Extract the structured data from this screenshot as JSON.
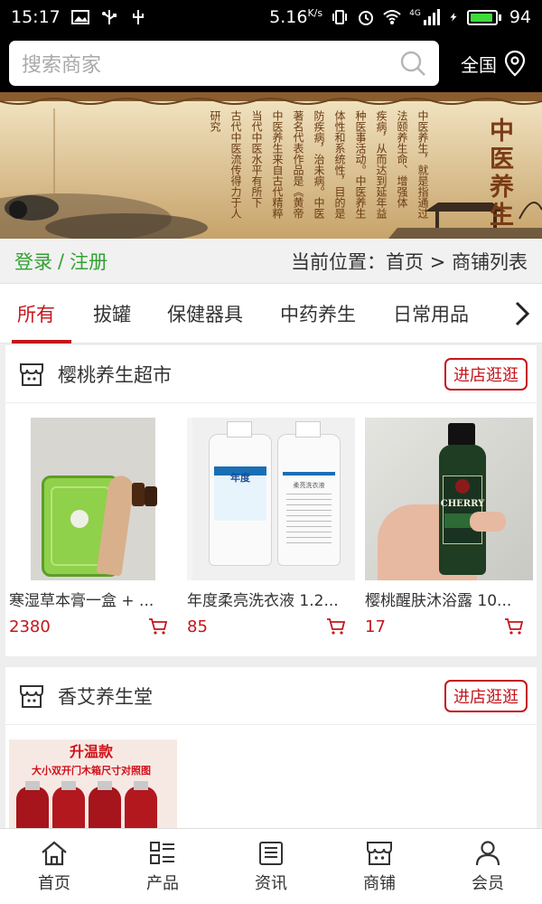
{
  "status_bar": {
    "time": "15:17",
    "speed": "5.16",
    "speed_unit": "K/s",
    "network": "4G",
    "battery": "94",
    "battery_level": 0.94,
    "icons": [
      "image-icon",
      "usb-icon",
      "vibrate-icon",
      "alarm-icon",
      "wifi-icon",
      "signal-icon",
      "charging-icon",
      "battery-icon"
    ]
  },
  "header": {
    "search_placeholder": "搜索商家",
    "region_label": "全国"
  },
  "banner": {
    "title": "中医养生",
    "columns": [
      "中医养生，就是指通过各种方",
      "法颐养生命、增强体质、预防",
      "疾病，从而达到延年益寿的一",
      "种医事活动。中医养生重在整",
      "体性和系统性，目的是提前预",
      "防疾病，治未病。中医理论的",
      "著名代表作品是《黄帝内经》",
      "中医养生来自古代精粹医学",
      "当代中医水平有所下降，而",
      "古代中医流传得力于人进步",
      "研究"
    ]
  },
  "breadcrumb": {
    "login": "登录",
    "separator": "/",
    "register": "注册",
    "position": "当前位置：首页 > 商铺列表"
  },
  "tabs": [
    {
      "label": "所有",
      "active": true
    },
    {
      "label": "拔罐",
      "active": false
    },
    {
      "label": "保健器具",
      "active": false
    },
    {
      "label": "中药养生",
      "active": false
    },
    {
      "label": "日常用品",
      "active": false
    }
  ],
  "shops": [
    {
      "name": "樱桃养生超市",
      "button": "进店逛逛",
      "products": [
        {
          "name": "寒湿草本膏一盒 + ...",
          "price": "2380"
        },
        {
          "name": "年度柔亮洗衣液 1.2...",
          "price": "85",
          "brand_text": "年度",
          "back_label": "柔亮洗衣液"
        },
        {
          "name": "樱桃醒肤沐浴露 10...",
          "price": "17",
          "brand_text": "CHERRY"
        }
      ]
    },
    {
      "name": "香艾养生堂",
      "button": "进店逛逛",
      "products": [
        {
          "name": "",
          "price": "",
          "image_title": "升温款",
          "image_subtitle": "大小双开门木箱尺寸对照图"
        }
      ]
    }
  ],
  "bottom_nav": [
    {
      "label": "首页",
      "icon": "home-icon"
    },
    {
      "label": "产品",
      "icon": "grid-list-icon"
    },
    {
      "label": "资讯",
      "icon": "news-icon"
    },
    {
      "label": "商铺",
      "icon": "shop-icon"
    },
    {
      "label": "会员",
      "icon": "user-icon"
    }
  ],
  "colors": {
    "accent": "#c4161c",
    "green": "#32a132",
    "header_bg": "#000000"
  }
}
